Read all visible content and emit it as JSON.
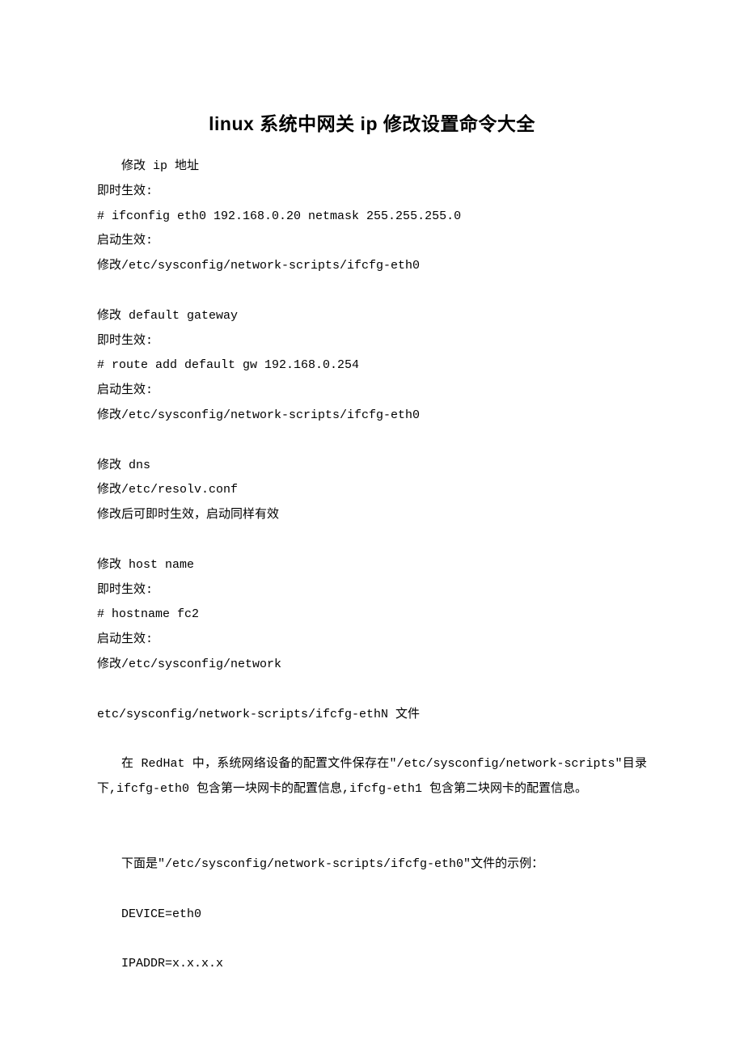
{
  "title": "linux 系统中网关 ip 修改设置命令大全",
  "s1": {
    "h": "修改 ip 地址",
    "l1": "即时生效:",
    "l2": "# ifconfig eth0 192.168.0.20 netmask 255.255.255.0",
    "l3": "启动生效:",
    "l4": "修改/etc/sysconfig/network-scripts/ifcfg-eth0"
  },
  "s2": {
    "h": "修改 default gateway",
    "l1": "即时生效:",
    "l2": "# route add default gw 192.168.0.254",
    "l3": "启动生效:",
    "l4": "修改/etc/sysconfig/network-scripts/ifcfg-eth0"
  },
  "s3": {
    "h": "修改 dns",
    "l1": "修改/etc/resolv.conf",
    "l2": "修改后可即时生效，启动同样有效"
  },
  "s4": {
    "h": "修改 host name",
    "l1": "即时生效:",
    "l2": "# hostname fc2",
    "l3": "启动生效:",
    "l4": "修改/etc/sysconfig/network"
  },
  "s5": {
    "l1": "etc/sysconfig/network-scripts/ifcfg-ethN 文件"
  },
  "p1": "在 RedHat 中，系统网络设备的配置文件保存在\"/etc/sysconfig/network-scripts\"目录下,ifcfg-eth0 包含第一块网卡的配置信息,ifcfg-eth1 包含第二块网卡的配置信息。",
  "p2": "下面是\"/etc/sysconfig/network-scripts/ifcfg-eth0\"文件的示例：",
  "s6": {
    "l1": "DEVICE=eth0",
    "l2": "IPADDR=x.x.x.x"
  }
}
